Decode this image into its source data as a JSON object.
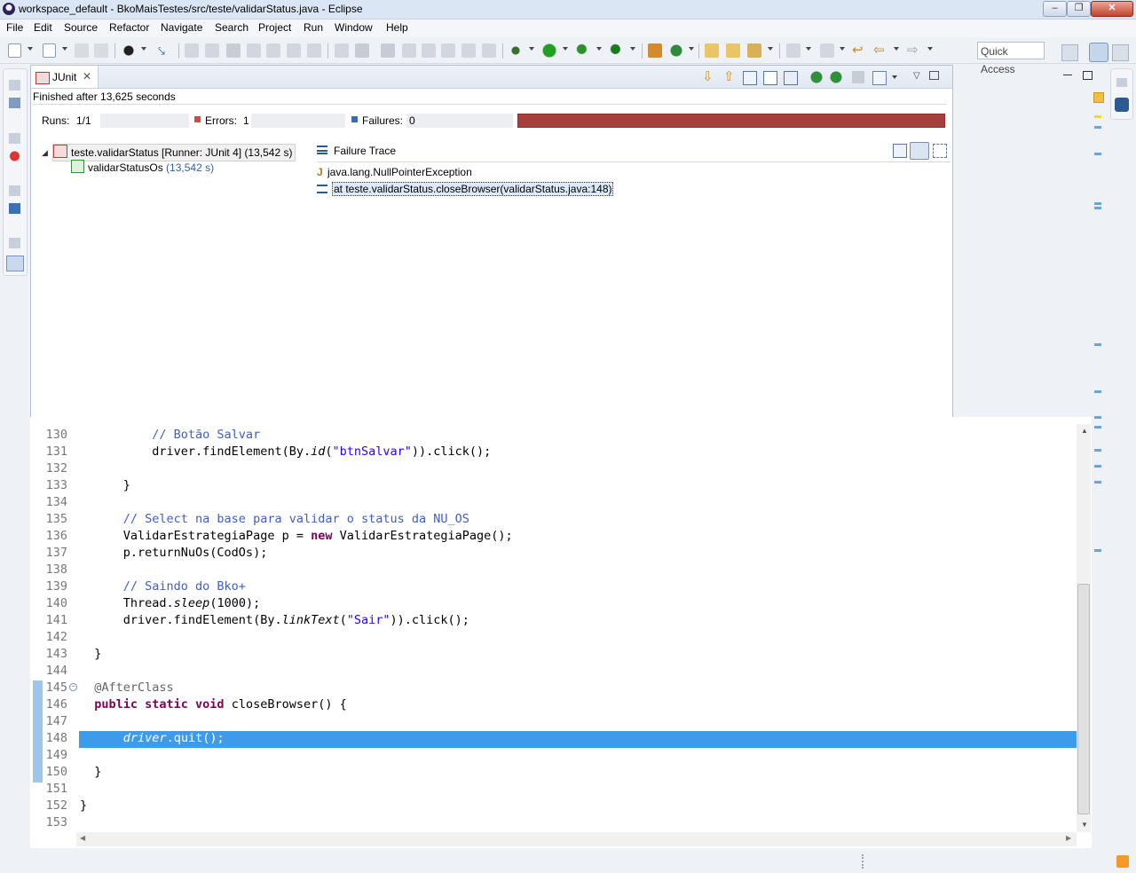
{
  "window": {
    "title": "workspace_default - BkoMaisTestes/src/teste/validarStatus.java - Eclipse",
    "controls": [
      "‒",
      "❐",
      "✕"
    ]
  },
  "menubar": {
    "items": [
      "File",
      "Edit",
      "Source",
      "Refactor",
      "Navigate",
      "Search",
      "Project",
      "Run",
      "Window",
      "Help"
    ]
  },
  "toolbar": {
    "quick_access": "Quick Access"
  },
  "junit": {
    "tab_label": "JUnit",
    "status": "Finished after 13,625 seconds",
    "runs_label": "Runs:",
    "runs_value": "1/1",
    "errors_label": "Errors:",
    "errors_value": "1",
    "failures_label": "Failures:",
    "failures_value": "0",
    "progress_color": "#a63f3c",
    "tree": {
      "suite_label": "teste.validarStatus [Runner: JUnit 4]",
      "suite_time": "(13,542 s)",
      "test_label": "validarStatusOs",
      "test_time": "(13,542 s)"
    },
    "failure_trace": {
      "title": "Failure Trace",
      "lines": [
        "java.lang.NullPointerException",
        "at teste.validarStatus.closeBrowser(validarStatus.java:148)"
      ]
    }
  },
  "editor": {
    "line_numbers": [
      "130",
      "131",
      "132",
      "133",
      "134",
      "135",
      "136",
      "137",
      "138",
      "139",
      "140",
      "141",
      "142",
      "143",
      "144",
      "145",
      "146",
      "147",
      "148",
      "149",
      "150",
      "151",
      "152",
      "153"
    ],
    "highlight_color": "#3d9be9"
  }
}
